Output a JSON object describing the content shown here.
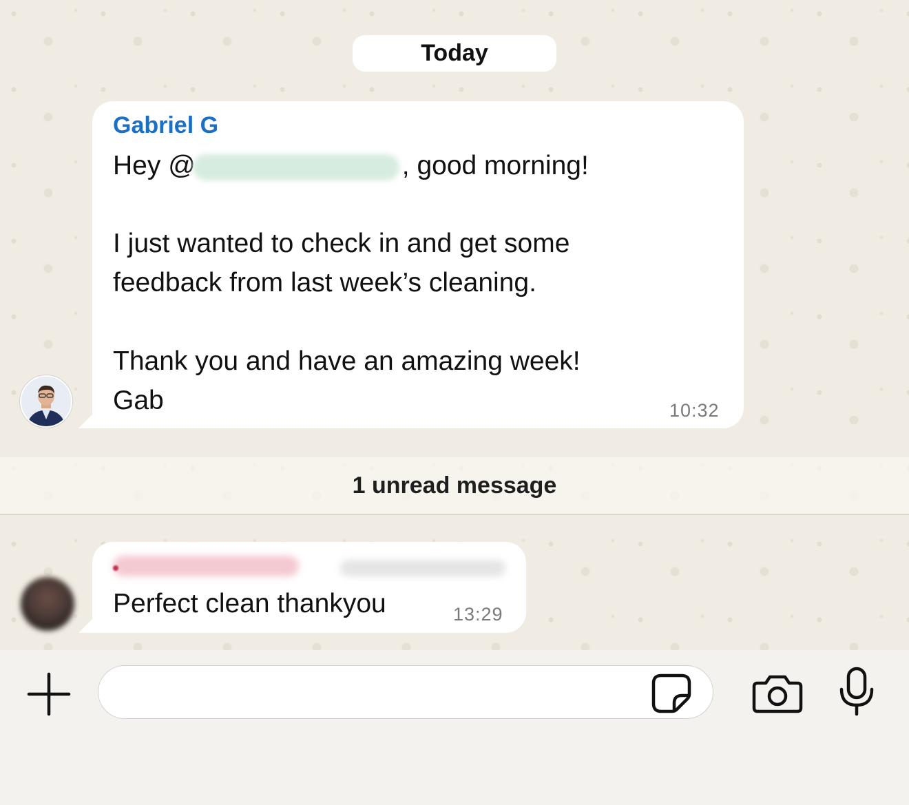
{
  "date_separator": "Today",
  "messages": [
    {
      "sender": "Gabriel G",
      "lines": [
        "Hey @",
        ", good morning!",
        "I just wanted to check in and get some",
        "feedback from last week’s cleaning.",
        "Thank you and have an amazing week!",
        "Gab"
      ],
      "time": "10:32",
      "avatar_icon": "profile-photo"
    },
    {
      "text": "Perfect clean thankyou",
      "time": "13:29",
      "avatar_icon": "blurred-profile-photo"
    }
  ],
  "unread_divider": "1 unread message",
  "composer": {
    "plus_icon": "plus-icon",
    "sticker_icon": "sticker-icon",
    "camera_icon": "camera-icon",
    "mic_icon": "microphone-icon",
    "placeholder": ""
  },
  "colors": {
    "sender_name": "#1c6fc3",
    "bubble": "#ffffff",
    "chat_background": "#f1ece3"
  }
}
